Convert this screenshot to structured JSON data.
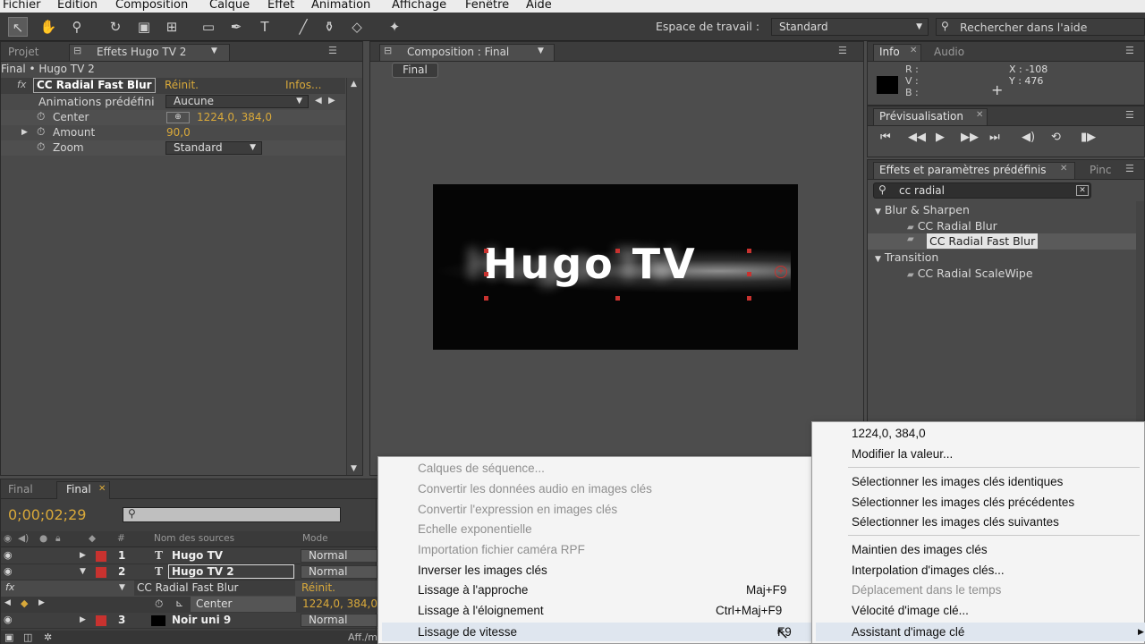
{
  "menubar": [
    "Fichier",
    "Edition",
    "Composition",
    "Calque",
    "Effet",
    "Animation",
    "Affichage",
    "Fenêtre",
    "Aide"
  ],
  "toolbar": {
    "workspace_label": "Espace de travail :",
    "workspace_value": "Standard",
    "help_placeholder": "Rechercher dans l'aide"
  },
  "project_panel": {
    "tabs": [
      "Projet",
      "Effets Hugo TV 2"
    ],
    "breadcrumb": "Final • Hugo TV 2",
    "effect_name": "CC Radial Fast Blur",
    "reset": "Réinit.",
    "infos": "Infos...",
    "presets_label": "Animations prédéfini",
    "presets_value": "Aucune",
    "props": [
      {
        "name": "Center",
        "value": "1224,0, 384,0"
      },
      {
        "name": "Amount",
        "value": "90,0"
      },
      {
        "name": "Zoom",
        "value": "Standard"
      }
    ]
  },
  "composition": {
    "tab": "Composition : Final",
    "sub_tab": "Final",
    "text": "Hugo TV"
  },
  "info_panel": {
    "tabs": [
      "Info",
      "Audio"
    ],
    "rgb": [
      "R :",
      "V :",
      "B :"
    ],
    "x": "X : -108",
    "y": "Y : 476"
  },
  "preview_panel": {
    "title": "Prévisualisation"
  },
  "effects_panel": {
    "tabs": [
      "Effets et paramètres prédéfinis",
      "Pinc"
    ],
    "search": "cc radial",
    "groups": [
      {
        "name": "Blur & Sharpen",
        "items": [
          "CC Radial Blur",
          "CC Radial Fast Blur"
        ]
      },
      {
        "name": "Transition",
        "items": [
          "CC Radial ScaleWipe"
        ]
      }
    ]
  },
  "timeline": {
    "tabs": [
      "Final",
      "Final"
    ],
    "timecode": "0;00;02;29",
    "col_source": "Nom des sources",
    "col_mode": "Mode",
    "col_num": "#",
    "layers": [
      {
        "num": "1",
        "name": "Hugo TV",
        "mode": "Normal"
      },
      {
        "num": "2",
        "name": "Hugo TV 2",
        "mode": "Normal"
      },
      {
        "num": "",
        "name": "CC Radial Fast Blur",
        "mode": "Réinit."
      },
      {
        "num": "",
        "name": "Center",
        "mode": "1224,0, 384,0"
      },
      {
        "num": "3",
        "name": "Noir uni 9",
        "mode": "Normal"
      }
    ],
    "footer": "Aff./m"
  },
  "left_menu": {
    "items": [
      {
        "label": "Calques de séquence...",
        "disabled": true,
        "shortcut": ""
      },
      {
        "label": "Convertir les données audio en images clés",
        "disabled": true,
        "shortcut": ""
      },
      {
        "label": "Convertir l'expression en images clés",
        "disabled": true,
        "shortcut": ""
      },
      {
        "label": "Echelle exponentielle",
        "disabled": true,
        "shortcut": ""
      },
      {
        "label": "Importation fichier caméra RPF",
        "disabled": true,
        "shortcut": ""
      },
      {
        "label": "Inverser les images clés",
        "disabled": false,
        "shortcut": ""
      },
      {
        "label": "Lissage à l'approche",
        "disabled": false,
        "shortcut": "Maj+F9"
      },
      {
        "label": "Lissage à l'éloignement",
        "disabled": false,
        "shortcut": "Ctrl+Maj+F9"
      },
      {
        "label": "Lissage de vitesse",
        "disabled": false,
        "shortcut": "F9"
      }
    ]
  },
  "right_menu": {
    "items": [
      {
        "label": "1224,0, 384,0",
        "disabled": false
      },
      {
        "label": "Modifier la valeur...",
        "disabled": false
      },
      {
        "label": "Sélectionner les images clés identiques",
        "disabled": false
      },
      {
        "label": "Sélectionner les images clés précédentes",
        "disabled": false
      },
      {
        "label": "Sélectionner les images clés suivantes",
        "disabled": false
      },
      {
        "label": "Maintien des images clés",
        "disabled": false
      },
      {
        "label": "Interpolation d'images clés...",
        "disabled": false
      },
      {
        "label": "Déplacement dans le temps",
        "disabled": true
      },
      {
        "label": "Vélocité d'image clé...",
        "disabled": false
      },
      {
        "label": "Assistant d'image clé",
        "disabled": false
      }
    ]
  },
  "colors": {
    "accent_yellow": "#d9a93a",
    "label_red": "#c8322f"
  }
}
